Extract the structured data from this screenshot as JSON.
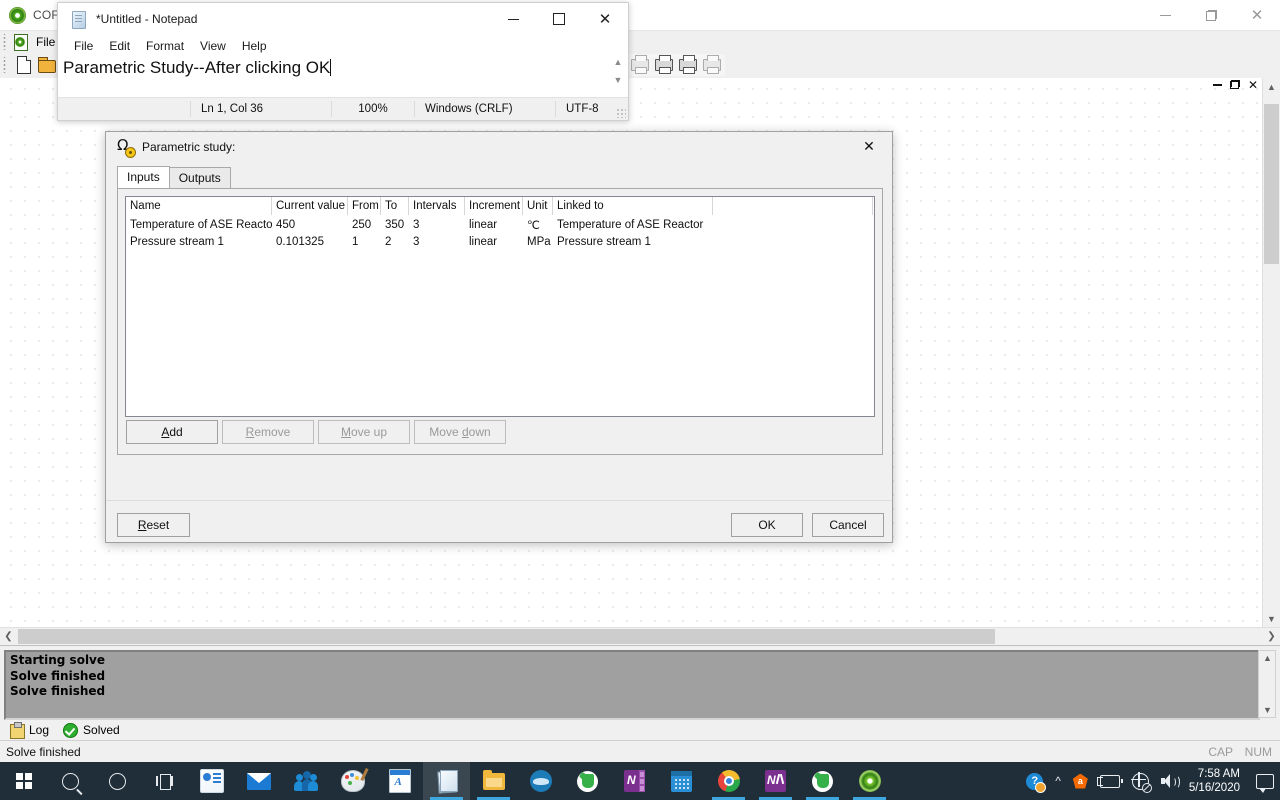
{
  "cofe": {
    "title": "COFE -",
    "menu": [
      "File"
    ],
    "window_controls": {
      "minimize": "minimize-icon",
      "restore": "restore-icon",
      "close": "close-icon"
    },
    "mdi_controls": {
      "minimize": "minimize-icon",
      "restore": "restore-icon",
      "close": "close-icon"
    },
    "toolbar_icons": [
      "new-document-icon",
      "open-folder-icon",
      "print-icon",
      "print-preview-icon",
      "quick-print-icon",
      "print-setup-icon"
    ],
    "log": {
      "lines": [
        "Starting solve",
        "Solve finished",
        "Solve finished"
      ],
      "tabs": [
        {
          "label": "Log",
          "icon": "clipboard-icon"
        },
        {
          "label": "Solved",
          "icon": "check-circle-icon"
        }
      ]
    },
    "statusbar": {
      "message": "Solve finished",
      "caps": "CAP",
      "num": "NUM"
    }
  },
  "notepad": {
    "title": "*Untitled - Notepad",
    "icon": "notepad-icon",
    "menu": [
      "File",
      "Edit",
      "Format",
      "View",
      "Help"
    ],
    "text": "Parametric Study--After clicking OK",
    "statusbar": {
      "position": "Ln 1, Col 36",
      "zoom": "100%",
      "line_ending": "Windows (CRLF)",
      "encoding": "UTF-8"
    },
    "window_controls": {
      "minimize": "minimize-icon",
      "maximize": "maximize-icon",
      "close": "close-icon"
    }
  },
  "dialog": {
    "title": "Parametric study:",
    "icon": "omega-gear-icon",
    "close": "close-icon",
    "tabs": [
      {
        "label": "Inputs",
        "active": true
      },
      {
        "label": "Outputs",
        "active": false
      }
    ],
    "grid": {
      "columns": [
        "Name",
        "Current value",
        "From",
        "To",
        "Intervals",
        "Increment",
        "Unit",
        "Linked to"
      ],
      "rows": [
        {
          "name": "Temperature of ASE Reactor",
          "current_value": "450",
          "from": "250",
          "to": "350",
          "intervals": "3",
          "increment": "linear",
          "unit": "℃",
          "linked_to": "Temperature of ASE Reactor"
        },
        {
          "name": "Pressure stream 1",
          "current_value": "0.101325",
          "from": "1",
          "to": "2",
          "intervals": "3",
          "increment": "linear",
          "unit": "MPa",
          "linked_to": "Pressure stream 1"
        }
      ]
    },
    "buttons": {
      "add": {
        "label": "Add",
        "enabled": true
      },
      "remove": {
        "label": "Remove",
        "enabled": false
      },
      "move_up": {
        "label": "Move up",
        "enabled": false
      },
      "move_down": {
        "label": "Move down",
        "enabled": false
      },
      "reset": {
        "label": "Reset",
        "enabled": true
      },
      "ok": {
        "label": "OK",
        "enabled": true
      },
      "cancel": {
        "label": "Cancel",
        "enabled": true
      }
    }
  },
  "taskbar": {
    "start": "windows-start-icon",
    "search": "search-icon",
    "cortana": "cortana-icon",
    "task_view": "task-view-icon",
    "apps": [
      "office-icon",
      "mail-icon",
      "people-icon",
      "paint-3d-icon",
      "word-icon",
      "notepad-icon",
      "file-explorer-icon",
      "blue-app-icon",
      "evernote-icon",
      "onenote-icon",
      "calendar-icon",
      "chrome-icon",
      "onenote-clipper-icon",
      "evernote-icon-2",
      "cofe-icon"
    ],
    "tray": {
      "help": "help-icon",
      "chevron": "show-hidden-icons-chevron",
      "avast": "avast-icon",
      "battery": "battery-icon",
      "network": "network-disconnected-icon",
      "volume": "volume-icon",
      "time": "7:58 AM",
      "date": "5/16/2020",
      "notifications": "action-center-icon"
    }
  },
  "colors": {
    "taskbar_bg": "#1f2e39",
    "dialog_bg": "#f0f0f0",
    "log_bg": "#a0a0a0",
    "accent_blue": "#3ea7e0",
    "solved_green": "#2eae2e"
  }
}
